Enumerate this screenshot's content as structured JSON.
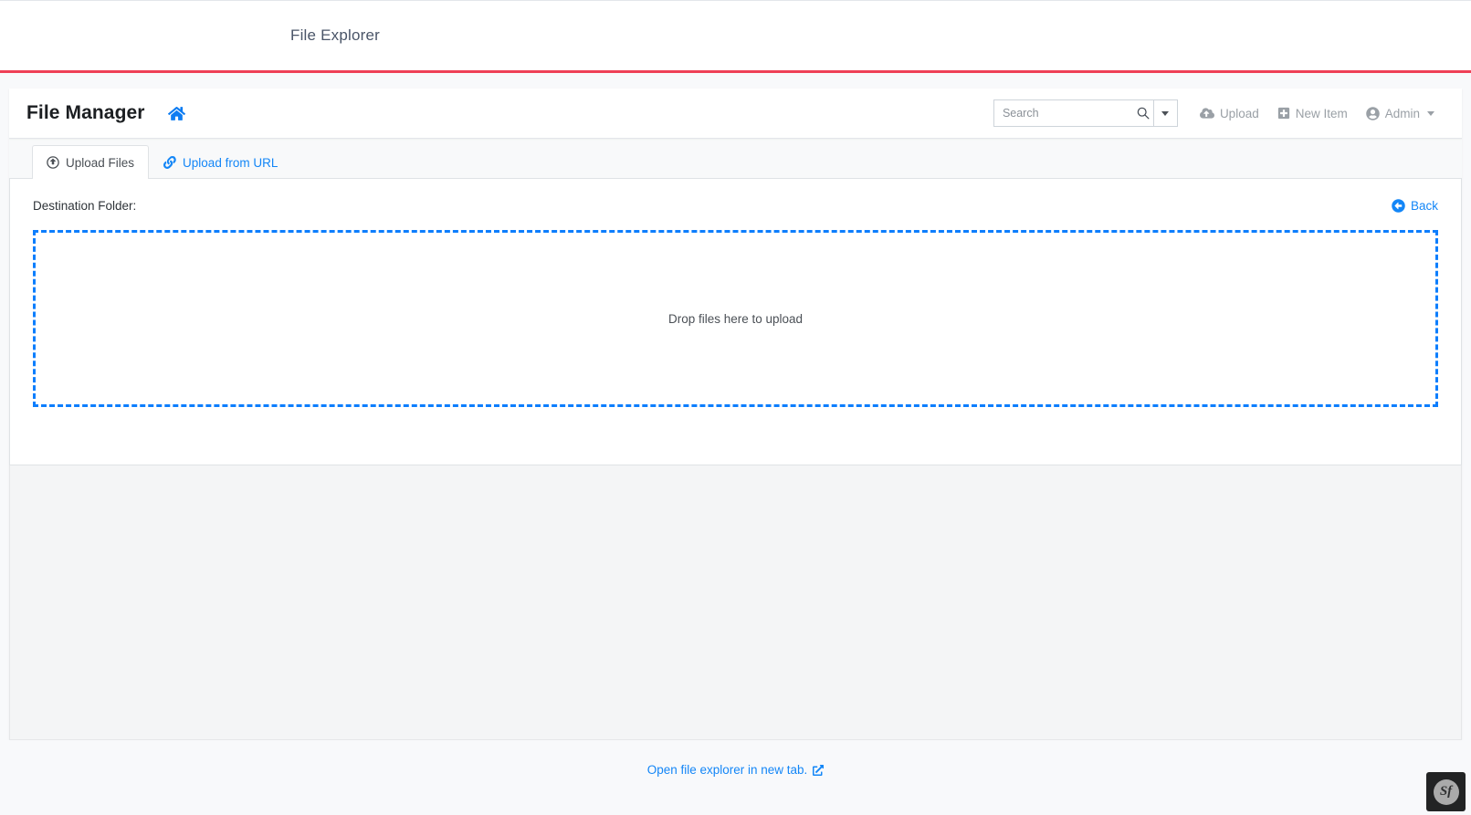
{
  "host": {
    "title": "File Explorer",
    "accent_rule_color": "#ef4056"
  },
  "navbar": {
    "brand": "File Manager",
    "home_icon": "home-icon",
    "search": {
      "placeholder": "Search",
      "value": "",
      "icon": "search-icon",
      "caret_icon": "chevron-down-icon"
    },
    "actions": [
      {
        "label": "Upload",
        "icon": "cloud-upload-icon"
      },
      {
        "label": "New Item",
        "icon": "plus-square-icon"
      },
      {
        "label": "Admin",
        "icon": "user-circle-icon",
        "has_caret": true
      }
    ]
  },
  "tabs": [
    {
      "label": "Upload Files",
      "icon": "arrow-up-circle-icon",
      "active": true
    },
    {
      "label": "Upload from URL",
      "icon": "link-chain-icon",
      "active": false
    }
  ],
  "pane": {
    "destination_label": "Destination Folder:",
    "back_label": "Back",
    "back_icon": "arrow-left-circle-icon",
    "dropzone_text": "Drop files here to upload",
    "dropzone_border_color": "#0d7efd"
  },
  "footer": {
    "link_label": "Open file explorer in new tab.",
    "link_icon": "external-link-icon",
    "link_color": "#1386f7"
  },
  "debug_toolbar": {
    "badge_label": "Sf",
    "name": "symfony-profiler-badge"
  }
}
